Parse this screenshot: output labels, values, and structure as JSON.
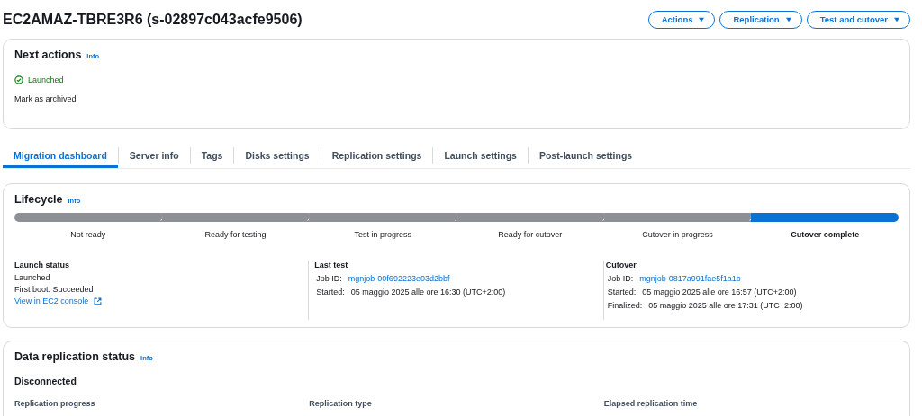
{
  "header": {
    "title": "EC2AMAZ-TBRE3R6 (s-02897c043acfe9506)",
    "buttons": [
      "Actions",
      "Replication",
      "Test and cutover"
    ]
  },
  "next_actions": {
    "title": "Next actions",
    "info": "Info",
    "status": "Launched",
    "action": "Mark as archived"
  },
  "tabs": [
    {
      "label": "Migration dashboard",
      "selected": true
    },
    {
      "label": "Server info",
      "selected": false
    },
    {
      "label": "Tags",
      "selected": false
    },
    {
      "label": "Disks settings",
      "selected": false
    },
    {
      "label": "Replication settings",
      "selected": false
    },
    {
      "label": "Launch settings",
      "selected": false
    },
    {
      "label": "Post-launch settings",
      "selected": false
    }
  ],
  "lifecycle": {
    "title": "Lifecycle",
    "info": "Info",
    "steps": [
      {
        "label": "Not ready",
        "selected": false
      },
      {
        "label": "Ready for testing",
        "selected": false
      },
      {
        "label": "Test in progress",
        "selected": false
      },
      {
        "label": "Ready for cutover",
        "selected": false
      },
      {
        "label": "Cutover in progress",
        "selected": false
      },
      {
        "label": "Cutover complete",
        "selected": true
      }
    ],
    "columns": [
      {
        "title": "Launch status",
        "lines": [
          {
            "kind": "text",
            "value": "Launched"
          },
          {
            "kind": "text",
            "value": "First boot: Succeeded"
          },
          {
            "kind": "external",
            "value": "View in EC2 console"
          }
        ]
      },
      {
        "title": "Last test",
        "lines": [
          {
            "kind": "link",
            "label": "Job ID:",
            "value": "mgnjob-00f692223e03d2bbf"
          },
          {
            "kind": "text",
            "label": "Started:",
            "value": "05 maggio 2025 alle ore 16:30 (UTC+2:00)"
          }
        ]
      },
      {
        "title": "Cutover",
        "lines": [
          {
            "kind": "link",
            "label": "Job ID:",
            "value": "mgnjob-0817a991fae5f1a1b"
          },
          {
            "kind": "text",
            "label": "Started:",
            "value": "05 maggio 2025 alle ore 16:57 (UTC+2:00)"
          },
          {
            "kind": "text",
            "label": "Finalized:",
            "value": "05 maggio 2025 alle ore 17:31 (UTC+2:00)"
          }
        ]
      }
    ]
  },
  "data_replication": {
    "title": "Data replication status",
    "info": "Info",
    "state": "Disconnected",
    "fields": [
      "Replication progress",
      "Replication type",
      "Elapsed replication time"
    ]
  }
}
